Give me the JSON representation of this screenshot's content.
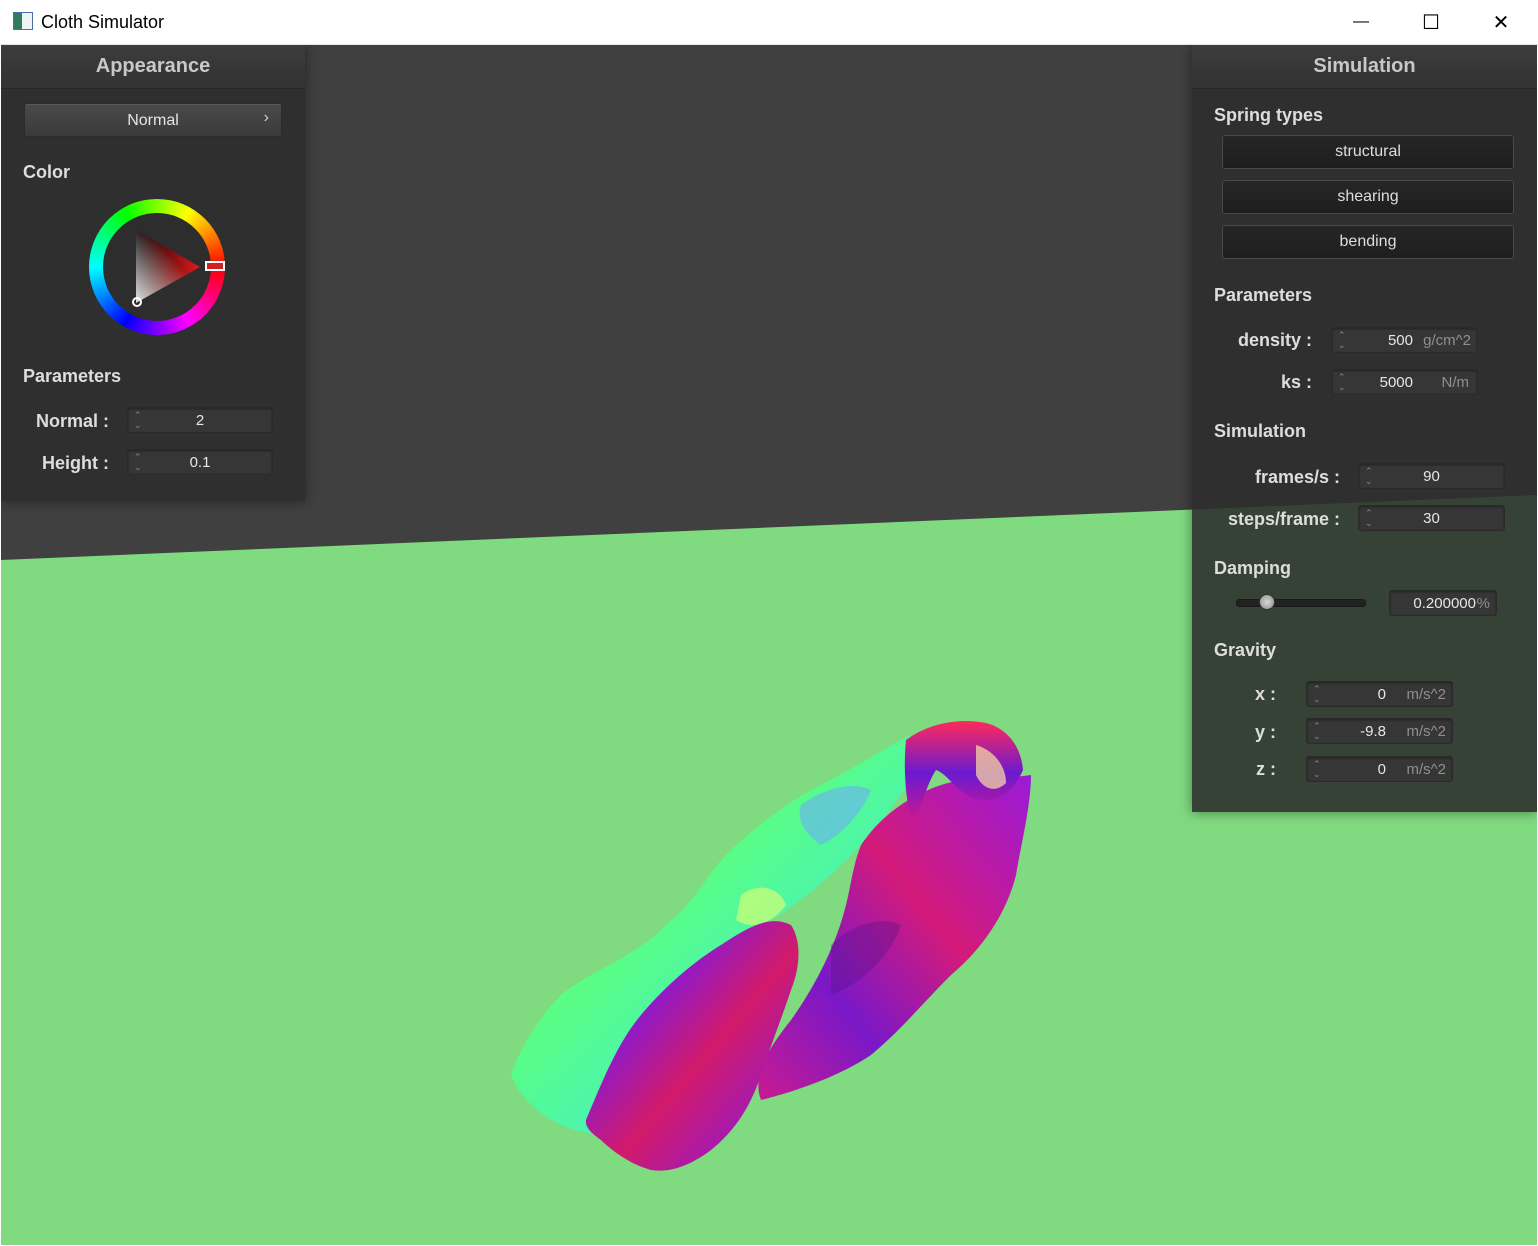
{
  "window": {
    "title": "Cloth Simulator",
    "minimize_label": "—",
    "maximize_label": "☐",
    "close_label": "✕"
  },
  "colors": {
    "floor": "#80da80",
    "background": "#404040",
    "panel": "#2c2c2c",
    "picker_selected": "#cc2222"
  },
  "appearance": {
    "title": "Appearance",
    "shader": {
      "selected": "Normal",
      "arrow": "›"
    },
    "color_label": "Color",
    "parameters_label": "Parameters",
    "normal": {
      "label": "Normal :",
      "value": "2"
    },
    "height": {
      "label": "Height :",
      "value": "0.1"
    }
  },
  "simulation_panel": {
    "title": "Simulation",
    "spring_types_label": "Spring types",
    "springs": [
      "structural",
      "shearing",
      "bending"
    ],
    "parameters_label": "Parameters",
    "density": {
      "label": "density :",
      "value": "500",
      "unit": "g/cm^2"
    },
    "ks": {
      "label": "ks :",
      "value": "5000",
      "unit": "N/m"
    },
    "simulation_label": "Simulation",
    "fps": {
      "label": "frames/s :",
      "value": "90"
    },
    "steps": {
      "label": "steps/frame :",
      "value": "30"
    },
    "damping_label": "Damping",
    "damping": {
      "value": "0.200000",
      "unit": "%",
      "fraction": 0.2
    },
    "gravity_label": "Gravity",
    "gravity": [
      {
        "label": "x :",
        "value": "0",
        "unit": "m/s^2"
      },
      {
        "label": "y :",
        "value": "-9.8",
        "unit": "m/s^2"
      },
      {
        "label": "z :",
        "value": "0",
        "unit": "m/s^2"
      }
    ]
  }
}
